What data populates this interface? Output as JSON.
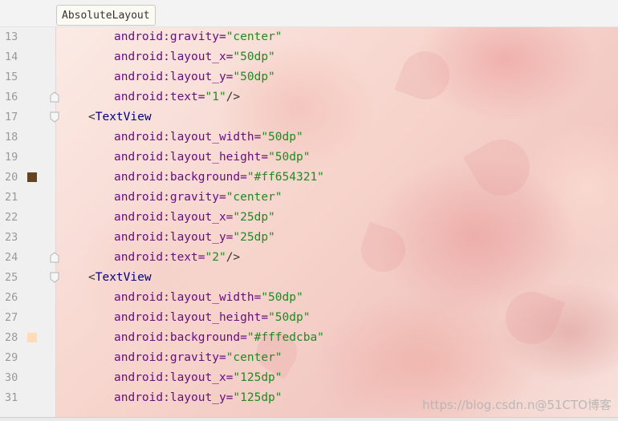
{
  "breadcrumb": {
    "label": "AbsoluteLayout"
  },
  "lines": [
    {
      "num": "13",
      "indent": 4,
      "attr": "android:gravity=",
      "value": "\"center\"",
      "close": ""
    },
    {
      "num": "14",
      "indent": 4,
      "attr": "android:layout_x=",
      "value": "\"50dp\"",
      "close": ""
    },
    {
      "num": "15",
      "indent": 4,
      "attr": "android:layout_y=",
      "value": "\"50dp\"",
      "close": ""
    },
    {
      "num": "16",
      "indent": 4,
      "attr": "android:text=",
      "value": "\"1\"",
      "close": "/>",
      "fold": "end"
    },
    {
      "num": "17",
      "indent": 2,
      "tag": "<TextView",
      "fold": "start"
    },
    {
      "num": "18",
      "indent": 4,
      "attr": "android:layout_width=",
      "value": "\"50dp\"",
      "close": ""
    },
    {
      "num": "19",
      "indent": 4,
      "attr": "android:layout_height=",
      "value": "\"50dp\"",
      "close": ""
    },
    {
      "num": "20",
      "indent": 4,
      "attr": "android:background=",
      "value": "\"#ff654321\"",
      "close": "",
      "swatch": "#654321"
    },
    {
      "num": "21",
      "indent": 4,
      "attr": "android:gravity=",
      "value": "\"center\"",
      "close": ""
    },
    {
      "num": "22",
      "indent": 4,
      "attr": "android:layout_x=",
      "value": "\"25dp\"",
      "close": ""
    },
    {
      "num": "23",
      "indent": 4,
      "attr": "android:layout_y=",
      "value": "\"25dp\"",
      "close": ""
    },
    {
      "num": "24",
      "indent": 4,
      "attr": "android:text=",
      "value": "\"2\"",
      "close": "/>",
      "fold": "end"
    },
    {
      "num": "25",
      "indent": 2,
      "tag": "<TextView",
      "fold": "start"
    },
    {
      "num": "26",
      "indent": 4,
      "attr": "android:layout_width=",
      "value": "\"50dp\"",
      "close": ""
    },
    {
      "num": "27",
      "indent": 4,
      "attr": "android:layout_height=",
      "value": "\"50dp\"",
      "close": ""
    },
    {
      "num": "28",
      "indent": 4,
      "attr": "android:background=",
      "value": "\"#fffedcba\"",
      "close": "",
      "swatch": "#fedcba"
    },
    {
      "num": "29",
      "indent": 4,
      "attr": "android:gravity=",
      "value": "\"center\"",
      "close": ""
    },
    {
      "num": "30",
      "indent": 4,
      "attr": "android:layout_x=",
      "value": "\"125dp\"",
      "close": ""
    },
    {
      "num": "31",
      "indent": 4,
      "attr": "android:layout_y=",
      "value": "\"125dp\"",
      "close": ""
    }
  ],
  "watermark": "https://blog.csdn.n@51CTO博客",
  "colors": {
    "attribute": "#660e7a",
    "string": "#218a21",
    "tag": "#000080",
    "line_number": "#999999"
  },
  "icons": {
    "fold_start": "fold-start-icon",
    "fold_end": "fold-end-icon",
    "color_swatch": "color-swatch-icon"
  }
}
